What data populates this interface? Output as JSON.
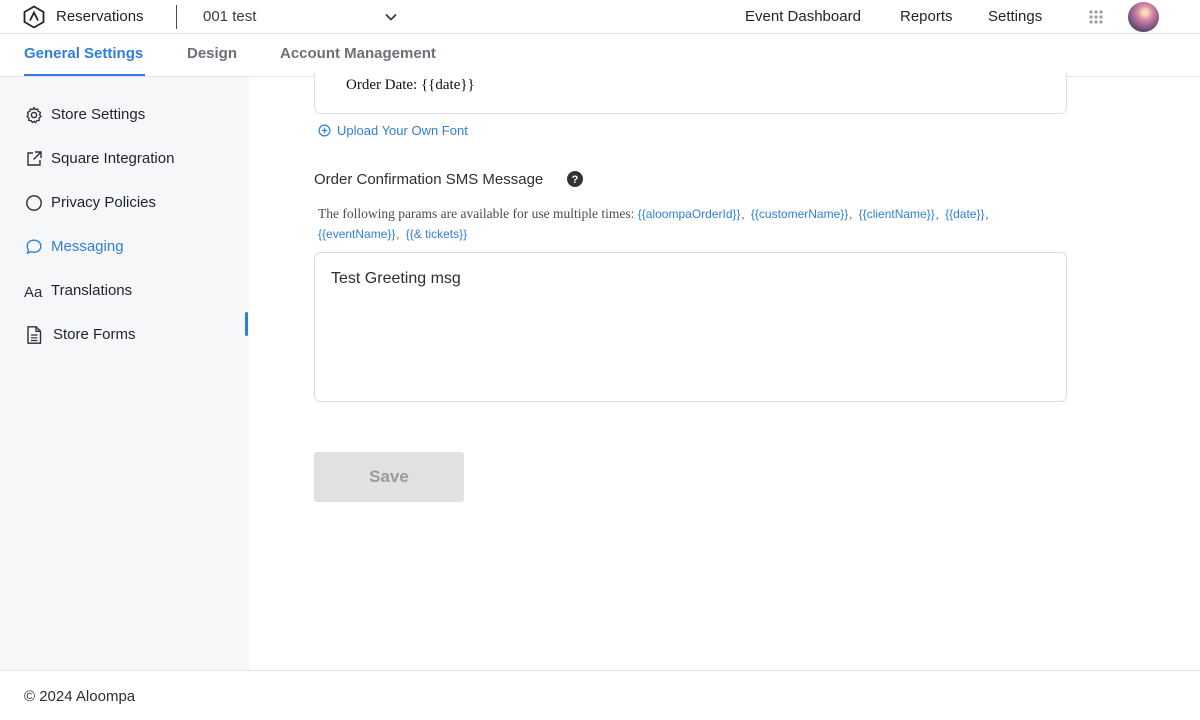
{
  "header": {
    "app_title": "Reservations",
    "store_selector": {
      "value": "001 test"
    },
    "nav": {
      "event_dashboard": "Event Dashboard",
      "reports": "Reports",
      "settings": "Settings"
    },
    "icons": {
      "logo": "aloompa-logo-icon",
      "apps": "apps-grid-icon",
      "chevron": "chevron-down-icon"
    }
  },
  "tabs": [
    {
      "label": "General Settings",
      "active": true
    },
    {
      "label": "Design",
      "active": false
    },
    {
      "label": "Account Management",
      "active": false
    }
  ],
  "sidebar": {
    "items": [
      {
        "label": "Store Settings",
        "icon": "gear-icon",
        "active": false
      },
      {
        "label": "Square Integration",
        "icon": "external-link-icon",
        "active": false
      },
      {
        "label": "Privacy Policies",
        "icon": "circle-icon",
        "active": false
      },
      {
        "label": "Messaging",
        "icon": "chat-bubble-icon",
        "active": true
      },
      {
        "label": "Translations",
        "icon": "font-aa-icon",
        "active": false
      },
      {
        "label": "Store Forms",
        "icon": "document-icon",
        "active": false
      }
    ]
  },
  "main": {
    "preview_line": {
      "label": "Order Date:",
      "token": "{{date}}"
    },
    "upload_font_link": "Upload Your Own Font",
    "sms_field": {
      "label": "Order Confirmation SMS Message",
      "params_intro": "The following params are available for use multiple times:",
      "params": [
        "{{aloompaOrderId}}",
        "{{customerName}}",
        "{{clientName}}",
        "{{date}}",
        "{{eventName}}",
        "{{& tickets}}"
      ],
      "value": "Test Greeting msg"
    },
    "save_button": "Save"
  },
  "footer": {
    "copyright": "© 2024 Aloompa"
  },
  "colors": {
    "accent": "#2f7fd8",
    "sidebar_bg": "#f6f7f9",
    "button_disabled": "#e1e1e1"
  }
}
